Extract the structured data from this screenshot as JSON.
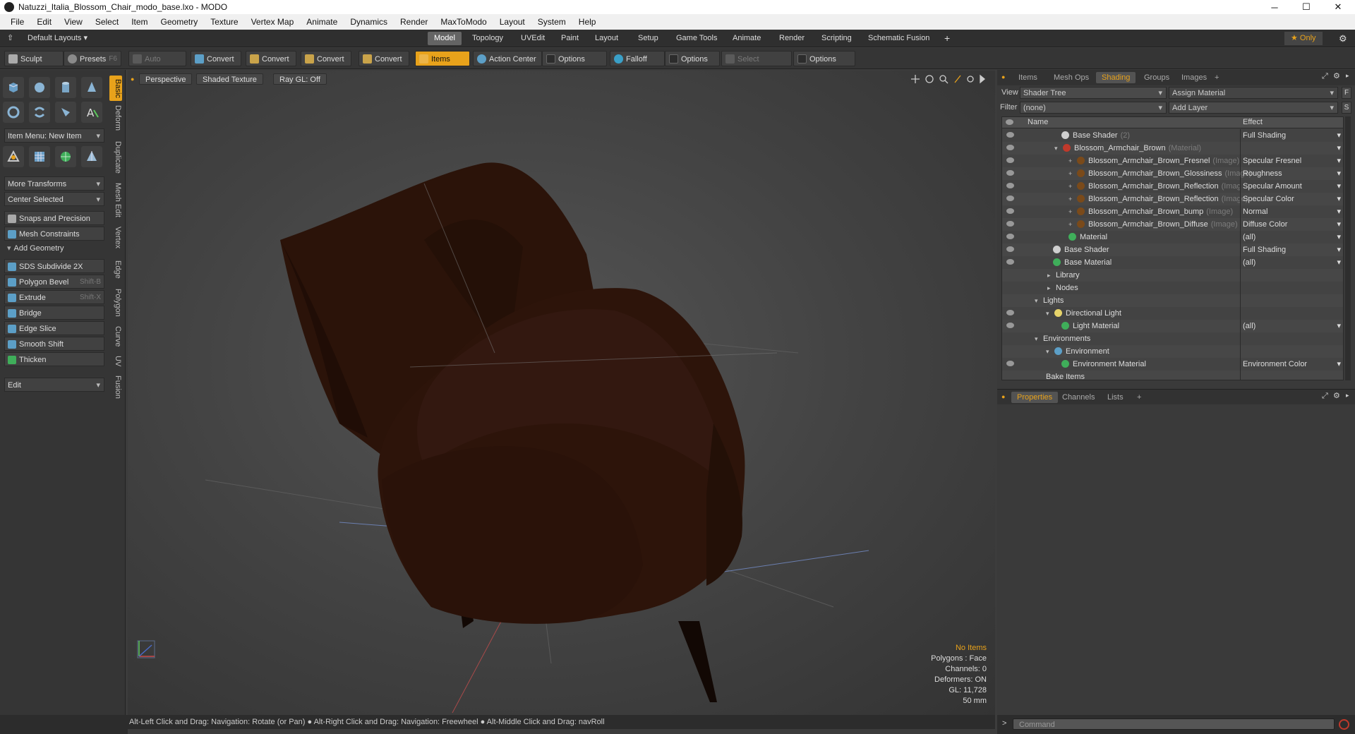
{
  "window": {
    "title": "Natuzzi_Italia_Blossom_Chair_modo_base.lxo - MODO"
  },
  "menu": [
    "File",
    "Edit",
    "View",
    "Select",
    "Item",
    "Geometry",
    "Texture",
    "Vertex Map",
    "Animate",
    "Dynamics",
    "Render",
    "MaxToModo",
    "Layout",
    "System",
    "Help"
  ],
  "layouts": {
    "default": "Default Layouts ▾",
    "tabs": [
      "Model",
      "Topology",
      "UVEdit",
      "Paint",
      "Layout",
      "Setup",
      "Game Tools",
      "Animate",
      "Render",
      "Scripting",
      "Schematic Fusion"
    ],
    "active": "Model",
    "add": "+",
    "only": "★ Only",
    "gear": "⚙"
  },
  "toolbar": {
    "sculpt": "Sculpt",
    "presets": "Presets",
    "presets_key": "F6",
    "auto_select": "Auto Select",
    "convert1": "Convert",
    "convert2": "Convert",
    "convert3": "Convert",
    "convert4": "Convert",
    "items": "Items",
    "action_center": "Action Center",
    "options1": "Options",
    "falloff": "Falloff",
    "options2": "Options",
    "select_through": "Select Through",
    "options3": "Options"
  },
  "left": {
    "item_menu": "Item Menu: New Item",
    "more_transforms": "More Transforms",
    "center_selected": "Center Selected",
    "snaps": "Snaps and Precision",
    "mesh_constraints": "Mesh Constraints",
    "add_geometry": "Add Geometry",
    "tools": [
      {
        "label": "SDS Subdivide 2X",
        "key": ""
      },
      {
        "label": "Polygon Bevel",
        "key": "Shift-B"
      },
      {
        "label": "Extrude",
        "key": "Shift-X"
      },
      {
        "label": "Bridge",
        "key": ""
      },
      {
        "label": "Edge Slice",
        "key": ""
      },
      {
        "label": "Smooth Shift",
        "key": ""
      },
      {
        "label": "Thicken",
        "key": ""
      }
    ],
    "edit": "Edit",
    "vtabs": [
      "Basic",
      "Deform",
      "Duplicate",
      "Mesh Edit",
      "Vertex",
      "Edge",
      "Polygon",
      "Curve",
      "UV",
      "Fusion"
    ]
  },
  "viewport": {
    "perspective": "Perspective",
    "shaded": "Shaded Texture",
    "raygl": "Ray GL: Off",
    "info": {
      "items": "No Items",
      "polygons": "Polygons : Face",
      "channels": "Channels: 0",
      "deformers": "Deformers: ON",
      "gl": "GL: 11,728",
      "scale": "50 mm"
    }
  },
  "status": "Alt-Left Click and Drag: Navigation: Rotate (or Pan) ● Alt-Right Click and Drag: Navigation: Freewheel ● Alt-Middle Click and Drag: navRoll",
  "right": {
    "tabs": [
      "Items",
      "Mesh Ops",
      "Shading",
      "Groups",
      "Images"
    ],
    "active_tab": "Shading",
    "add": "+",
    "view_label": "View",
    "view_value": "Shader Tree",
    "assign": "Assign Material",
    "assign_key": "F",
    "filter_label": "Filter",
    "filter_value": "(none)",
    "add_layer": "Add Layer",
    "add_layer_key": "S",
    "col_name": "Name",
    "col_effect": "Effect",
    "rows": [
      {
        "name": "Base Shader",
        "sub": "(2)",
        "effect": "Full Shading",
        "indent": 60,
        "ball": "#cfcfcf",
        "eye": true,
        "exp": "",
        "dd": true
      },
      {
        "name": "Blossom_Armchair_Brown",
        "sub": "(Material)",
        "effect": "",
        "indent": 50,
        "ball": "#c0392b",
        "eye": true,
        "exp": "▾",
        "dd": true
      },
      {
        "name": "Blossom_Armchair_Brown_Fresnel",
        "sub": "(Image)",
        "effect": "Specular Fresnel",
        "indent": 70,
        "ball": "#7a4a1a",
        "eye": true,
        "exp": "+",
        "dd": true
      },
      {
        "name": "Blossom_Armchair_Brown_Glossiness",
        "sub": "(Image)",
        "effect": "Roughness",
        "indent": 70,
        "ball": "#7a4a1a",
        "eye": true,
        "exp": "+",
        "dd": true
      },
      {
        "name": "Blossom_Armchair_Brown_Reflection",
        "sub": "(Imag ...",
        "effect": "Specular Amount",
        "indent": 70,
        "ball": "#7a4a1a",
        "eye": true,
        "exp": "+",
        "dd": true
      },
      {
        "name": "Blossom_Armchair_Brown_Reflection",
        "sub": "(Image)",
        "effect": "Specular Color",
        "indent": 70,
        "ball": "#7a4a1a",
        "eye": true,
        "exp": "+",
        "dd": true
      },
      {
        "name": "Blossom_Armchair_Brown_bump",
        "sub": "(Image)",
        "effect": "Normal",
        "indent": 70,
        "ball": "#7a4a1a",
        "eye": true,
        "exp": "+",
        "dd": true
      },
      {
        "name": "Blossom_Armchair_Brown_Diffuse",
        "sub": "(Image)",
        "effect": "Diffuse Color",
        "indent": 70,
        "ball": "#7a4a1a",
        "eye": true,
        "exp": "+",
        "dd": true
      },
      {
        "name": "Material",
        "sub": "",
        "effect": "(all)",
        "indent": 70,
        "ball": "#3fae5a",
        "eye": true,
        "exp": "",
        "dd": true
      },
      {
        "name": "Base Shader",
        "sub": "",
        "effect": "Full Shading",
        "indent": 48,
        "ball": "#cfcfcf",
        "eye": true,
        "exp": "",
        "dd": true
      },
      {
        "name": "Base Material",
        "sub": "",
        "effect": "(all)",
        "indent": 48,
        "ball": "#3fae5a",
        "eye": true,
        "exp": "",
        "dd": true
      },
      {
        "name": "Library",
        "sub": "",
        "effect": "",
        "indent": 40,
        "ball": "",
        "eye": false,
        "exp": "▸",
        "dd": false
      },
      {
        "name": "Nodes",
        "sub": "",
        "effect": "",
        "indent": 40,
        "ball": "",
        "eye": false,
        "exp": "▸",
        "dd": false
      },
      {
        "name": "Lights",
        "sub": "",
        "effect": "",
        "indent": 22,
        "ball": "",
        "eye": false,
        "exp": "▾",
        "dd": false
      },
      {
        "name": "Directional Light",
        "sub": "",
        "effect": "",
        "indent": 38,
        "ball": "#e6d36a",
        "eye": true,
        "exp": "▾",
        "dd": false
      },
      {
        "name": "Light Material",
        "sub": "",
        "effect": "(all)",
        "indent": 60,
        "ball": "#3fae5a",
        "eye": true,
        "exp": "",
        "dd": true
      },
      {
        "name": "Environments",
        "sub": "",
        "effect": "",
        "indent": 22,
        "ball": "",
        "eye": false,
        "exp": "▾",
        "dd": false
      },
      {
        "name": "Environment",
        "sub": "",
        "effect": "",
        "indent": 38,
        "ball": "#5c9fc7",
        "eye": false,
        "exp": "▾",
        "dd": false
      },
      {
        "name": "Environment Material",
        "sub": "",
        "effect": "Environment Color",
        "indent": 60,
        "ball": "#3fae5a",
        "eye": true,
        "exp": "",
        "dd": true
      },
      {
        "name": "Bake Items",
        "sub": "",
        "effect": "",
        "indent": 38,
        "ball": "",
        "eye": false,
        "exp": "",
        "dd": false
      }
    ],
    "bottom_tabs": [
      "Properties",
      "Channels",
      "Lists"
    ],
    "bottom_active": "Properties",
    "command_placeholder": "Command",
    "cmd_arrow": ">"
  },
  "colors": {
    "accent": "#e8a21b",
    "chair": "#2a1208"
  }
}
